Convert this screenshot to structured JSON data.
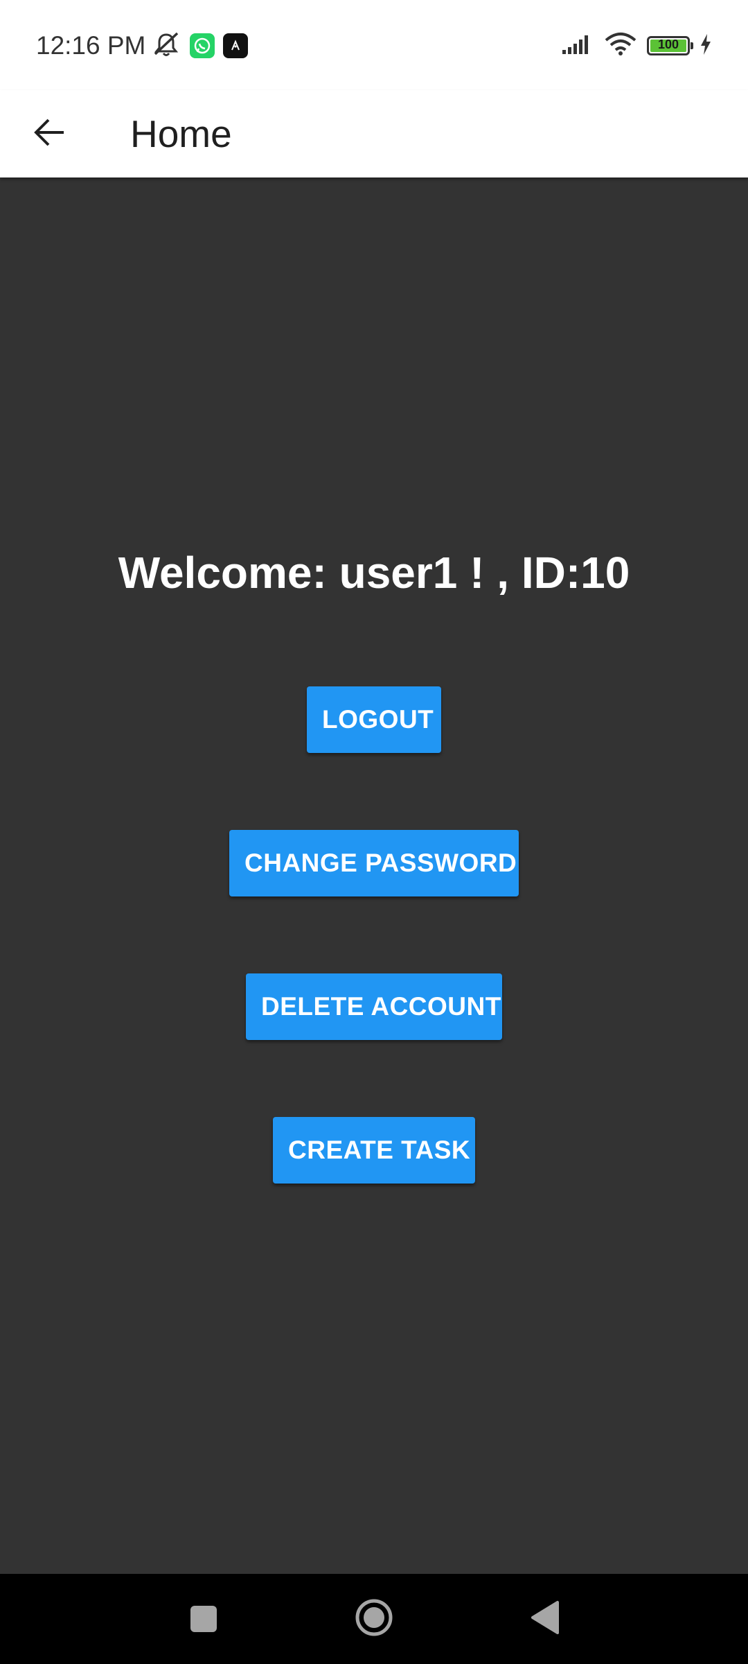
{
  "status_bar": {
    "time": "12:16 PM",
    "battery_level": "100",
    "icons": [
      "mute-icon",
      "whatsapp-icon",
      "app-icon",
      "signal-icon",
      "wifi-icon",
      "battery-icon",
      "charging-icon"
    ]
  },
  "app_bar": {
    "title": "Home",
    "back_icon": "arrow-back-icon"
  },
  "main": {
    "welcome_text": "Welcome: user1 ! , ID:10",
    "buttons": {
      "logout": "LOGOUT",
      "change_password": "CHANGE PASSWORD",
      "delete_account": "DELETE ACCOUNT",
      "create_task": "CREATE TASK"
    }
  },
  "nav_bar": {
    "icons": [
      "recents-icon",
      "home-icon",
      "back-icon"
    ]
  },
  "colors": {
    "accent": "#2196f3",
    "background": "#333333",
    "app_bar": "#ffffff",
    "nav_bar": "#000000"
  }
}
